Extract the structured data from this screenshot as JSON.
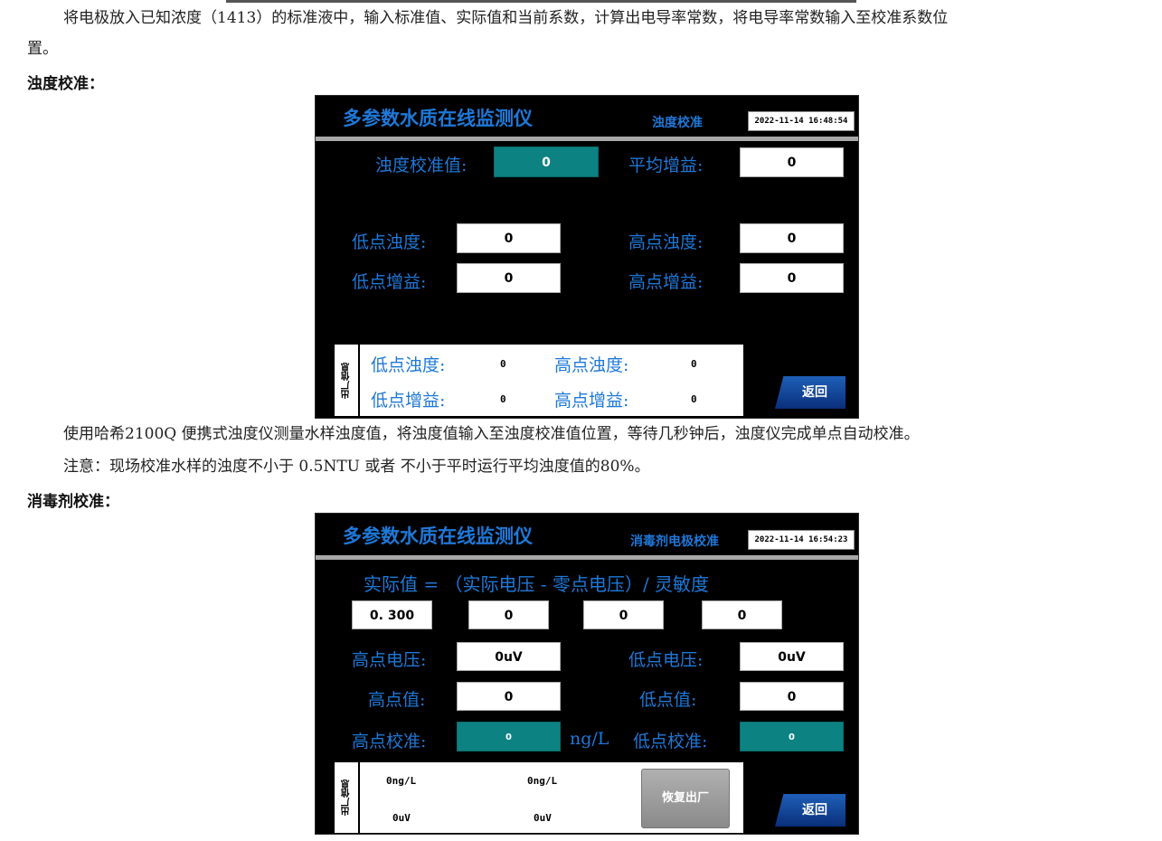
{
  "doc": {
    "para1_line1": "将电极放入已知浓度（1413）的标准液中，输入标准值、实际值和当前系数，计算出电导率常数，将电导率常数输入至校准系数位",
    "para1_line2": "置。",
    "heading_turbidity": "浊度校准：",
    "para2": "使用哈希2100Q 便携式浊度仪测量水样浊度值，将浊度值输入至浊度校准值位置，等待几秒钟后，浊度仪完成单点自动校准。",
    "para3": "注意：现场校准水样的浊度不小于  0.5NTU 或者  不小于平时运行平均浊度值的80%。",
    "heading_disinfectant": "消毒剂校准："
  },
  "screen1": {
    "title": "多参数水质在线监测仪",
    "page_name": "浊度校准",
    "clock": "2022-11-14 16:48:54",
    "calib_label": "浊度校准值:",
    "calib_value": "0",
    "avg_gain_label": "平均增益:",
    "avg_gain_value": "0",
    "low_turb_label": "低点浊度:",
    "low_turb_value": "0",
    "high_turb_label": "高点浊度:",
    "high_turb_value": "0",
    "low_gain_label": "低点增益:",
    "low_gain_value": "0",
    "high_gain_label": "高点增益:",
    "high_gain_value": "0",
    "factory": {
      "side_label": "出厂信息",
      "low_turb_label": "低点浊度:",
      "low_turb_value": "0",
      "high_turb_label": "高点浊度:",
      "high_turb_value": "0",
      "low_gain_label": "低点增益:",
      "low_gain_value": "0",
      "high_gain_label": "高点增益:",
      "high_gain_value": "0"
    },
    "back_label": "返回"
  },
  "screen2": {
    "title": "多参数水质在线监测仪",
    "page_name": "消毒剂电极校准",
    "clock": "2022-11-14 16:54:23",
    "formula": "实际值 = （实际电压 - 零点电压）/ 灵敏度",
    "formula_values": [
      "0. 300",
      "0",
      "0",
      "0"
    ],
    "high_voltage_label": "高点电压:",
    "high_voltage_value": "0uV",
    "low_voltage_label": "低点电压:",
    "low_voltage_value": "0uV",
    "high_value_label": "高点值:",
    "high_value_value": "0",
    "low_value_label": "低点值:",
    "low_value_value": "0",
    "high_calib_label": "高点校准:",
    "high_calib_value": "0",
    "unit": "ng/L",
    "low_calib_label": "低点校准:",
    "low_calib_value": "0",
    "factory": {
      "side_label": "出厂信息",
      "conc1": "0ng/L",
      "conc2": "0ng/L",
      "volt1": "0uV",
      "volt2": "0uV"
    },
    "restore_label": "恢复出厂",
    "back_label": "返回"
  }
}
